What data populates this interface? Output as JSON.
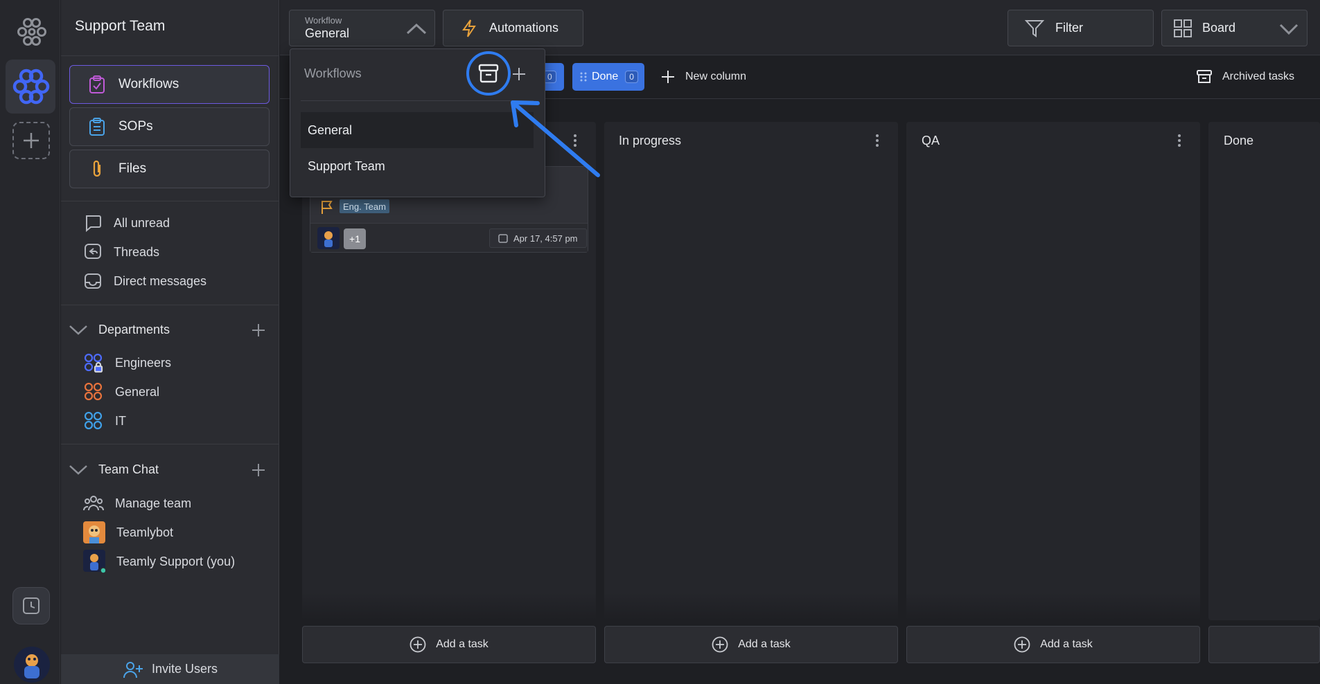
{
  "team": {
    "name": "Support Team"
  },
  "sidebar": {
    "nav_buttons": [
      {
        "label": "Workflows",
        "icon": "clipboard-check-icon",
        "active": true
      },
      {
        "label": "SOPs",
        "icon": "clipboard-list-icon"
      },
      {
        "label": "Files",
        "icon": "paperclip-icon"
      }
    ],
    "quick": [
      {
        "label": "All unread",
        "icon": "chat-bubble-icon"
      },
      {
        "label": "Threads",
        "icon": "reply-thread-icon"
      },
      {
        "label": "Direct messages",
        "icon": "inbox-icon"
      }
    ],
    "departments": {
      "title": "Departments",
      "items": [
        {
          "label": "Engineers",
          "color": "#4d6bff"
        },
        {
          "label": "General",
          "color": "#e8733c"
        },
        {
          "label": "IT",
          "color": "#3fa0e8"
        }
      ]
    },
    "team_chat": {
      "title": "Team Chat",
      "items": [
        {
          "label": "Manage team",
          "icon": "team-icon"
        },
        {
          "label": "Teamlybot",
          "icon": "bot-avatar"
        },
        {
          "label": "Teamly Support (you)",
          "icon": "user-avatar"
        }
      ]
    },
    "invite_label": "Invite Users"
  },
  "topbar": {
    "workflow_caption": "Workflow",
    "workflow_value": "General",
    "automations_label": "Automations",
    "filter_label": "Filter",
    "view_label": "Board"
  },
  "column_tools": {
    "chips": [
      {
        "label": "",
        "count": "0"
      },
      {
        "label": "Done",
        "count": "0"
      }
    ],
    "new_column_label": "New column",
    "archived_label": "Archived tasks"
  },
  "columns": [
    {
      "title": "",
      "add_label": "Add a task"
    },
    {
      "title": "In progress",
      "add_label": "Add a task"
    },
    {
      "title": "QA",
      "add_label": "Add a task"
    },
    {
      "title": "Done",
      "add_label": ""
    }
  ],
  "card": {
    "tag": "Eng. Team",
    "extra_assignees": "+1",
    "date": "Apr 17, 4:57 pm"
  },
  "workflow_dropdown": {
    "title": "Workflows",
    "items": [
      {
        "label": "General",
        "selected": true
      },
      {
        "label": "Support Team"
      }
    ]
  },
  "colors": {
    "accent_blue": "#3a72e0",
    "highlight_ring": "#2f7cf0",
    "active_border": "#6d5ae0"
  }
}
